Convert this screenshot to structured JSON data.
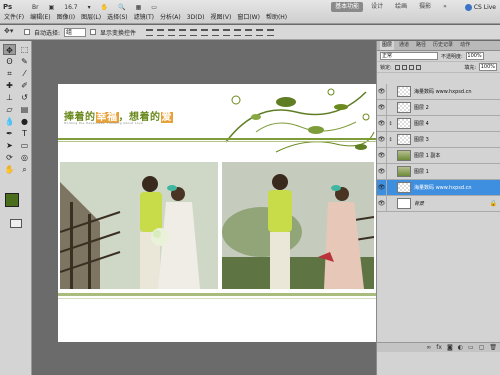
{
  "app": {
    "logo": "Ps",
    "zoom": "16.7",
    "menus": [
      "文件(F)",
      "编辑(E)",
      "图像(I)",
      "图层(L)",
      "选择(S)",
      "滤镜(T)",
      "分析(A)",
      "3D(D)",
      "视图(V)",
      "窗口(W)",
      "帮助(H)"
    ],
    "workspaces": [
      "基本功能",
      "设计",
      "绘画",
      "摄影"
    ],
    "active_workspace": "基本功能",
    "cs_live": "CS Live"
  },
  "options": {
    "auto_select_label": "自动选择:",
    "auto_select_value": "组",
    "show_transform_label": "显示变换控件"
  },
  "document": {
    "title_pre": "捧着的",
    "title_hl1": "幸福",
    "title_mid": "，想着的",
    "title_hl2": "爱",
    "subtitle": "Holding the Happiness, Thinking About Love",
    "accent_color": "#7f9c3a",
    "highlight_color": "#e8a23c"
  },
  "tools": [
    "move-tool",
    "marquee-tool",
    "lasso-tool",
    "quick-select-tool",
    "crop-tool",
    "eyedropper-tool",
    "healing-tool",
    "brush-tool",
    "clone-stamp-tool",
    "history-brush-tool",
    "eraser-tool",
    "gradient-tool",
    "blur-tool",
    "dodge-tool",
    "pen-tool",
    "type-tool",
    "path-select-tool",
    "shape-tool",
    "3d-rotate-tool",
    "3d-orbit-tool",
    "hand-tool",
    "zoom-tool"
  ],
  "layers_panel": {
    "tabs": [
      "图层",
      "通道",
      "路径",
      "历史记录",
      "动作"
    ],
    "blend_mode": "正常",
    "opacity_label": "不透明度:",
    "opacity_value": "100%",
    "lock_label": "锁定:",
    "fill_label": "填充:",
    "fill_value": "100%",
    "layers": [
      {
        "name": "海量数码 www.hxpsd.cn",
        "thumb": "checker",
        "active": false,
        "linked": false
      },
      {
        "name": "图层 2",
        "thumb": "checker",
        "active": false,
        "linked": false
      },
      {
        "name": "图层 4",
        "thumb": "checker",
        "active": false,
        "linked": true
      },
      {
        "name": "图层 3",
        "thumb": "checker",
        "active": false,
        "linked": true
      },
      {
        "name": "图层 1 副本",
        "thumb": "photo",
        "active": false,
        "linked": false
      },
      {
        "name": "图层 1",
        "thumb": "photo",
        "active": false,
        "linked": false
      },
      {
        "name": "海量数码 www.hxpsd.cn",
        "thumb": "checker",
        "active": true,
        "linked": false
      },
      {
        "name": "背景",
        "thumb": "white",
        "active": false,
        "linked": false,
        "italic": true,
        "locked": true
      }
    ],
    "bottom_icons": [
      "link-icon",
      "fx-icon",
      "mask-icon",
      "adjustment-icon",
      "folder-icon",
      "new-layer-icon",
      "trash-icon"
    ]
  }
}
